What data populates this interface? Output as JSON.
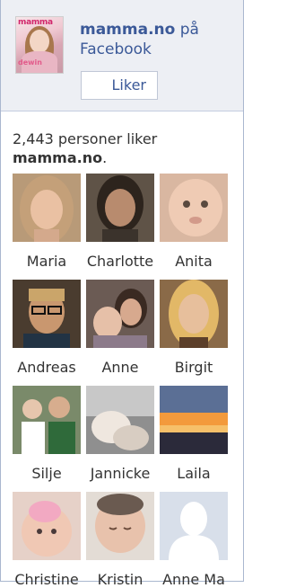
{
  "page": {
    "name": "mamma.no",
    "suffix": "på Facebook",
    "like_button": "Liker",
    "logo_masthead": "mamma",
    "logo_badge": "dewin"
  },
  "likes": {
    "count_text": "2,443 personer liker",
    "page_name": "mamma.no",
    "page_name_suffix": "."
  },
  "fans": [
    {
      "name": "Maria",
      "photo": "woman-blonde"
    },
    {
      "name": "Charlotte",
      "photo": "woman-dark"
    },
    {
      "name": "Anita",
      "photo": "baby"
    },
    {
      "name": "Andreas",
      "photo": "man-glasses"
    },
    {
      "name": "Anne",
      "photo": "woman-with-baby"
    },
    {
      "name": "Birgit",
      "photo": "woman-blonde-2"
    },
    {
      "name": "Silje",
      "photo": "family-group"
    },
    {
      "name": "Jannicke",
      "photo": "child-sleeping"
    },
    {
      "name": "Laila",
      "photo": "sunset"
    },
    {
      "name": "Christine",
      "photo": "baby-pink"
    },
    {
      "name": "Kristin",
      "photo": "newborn"
    },
    {
      "name": "Anne Ma",
      "photo": "default-silhouette"
    }
  ]
}
